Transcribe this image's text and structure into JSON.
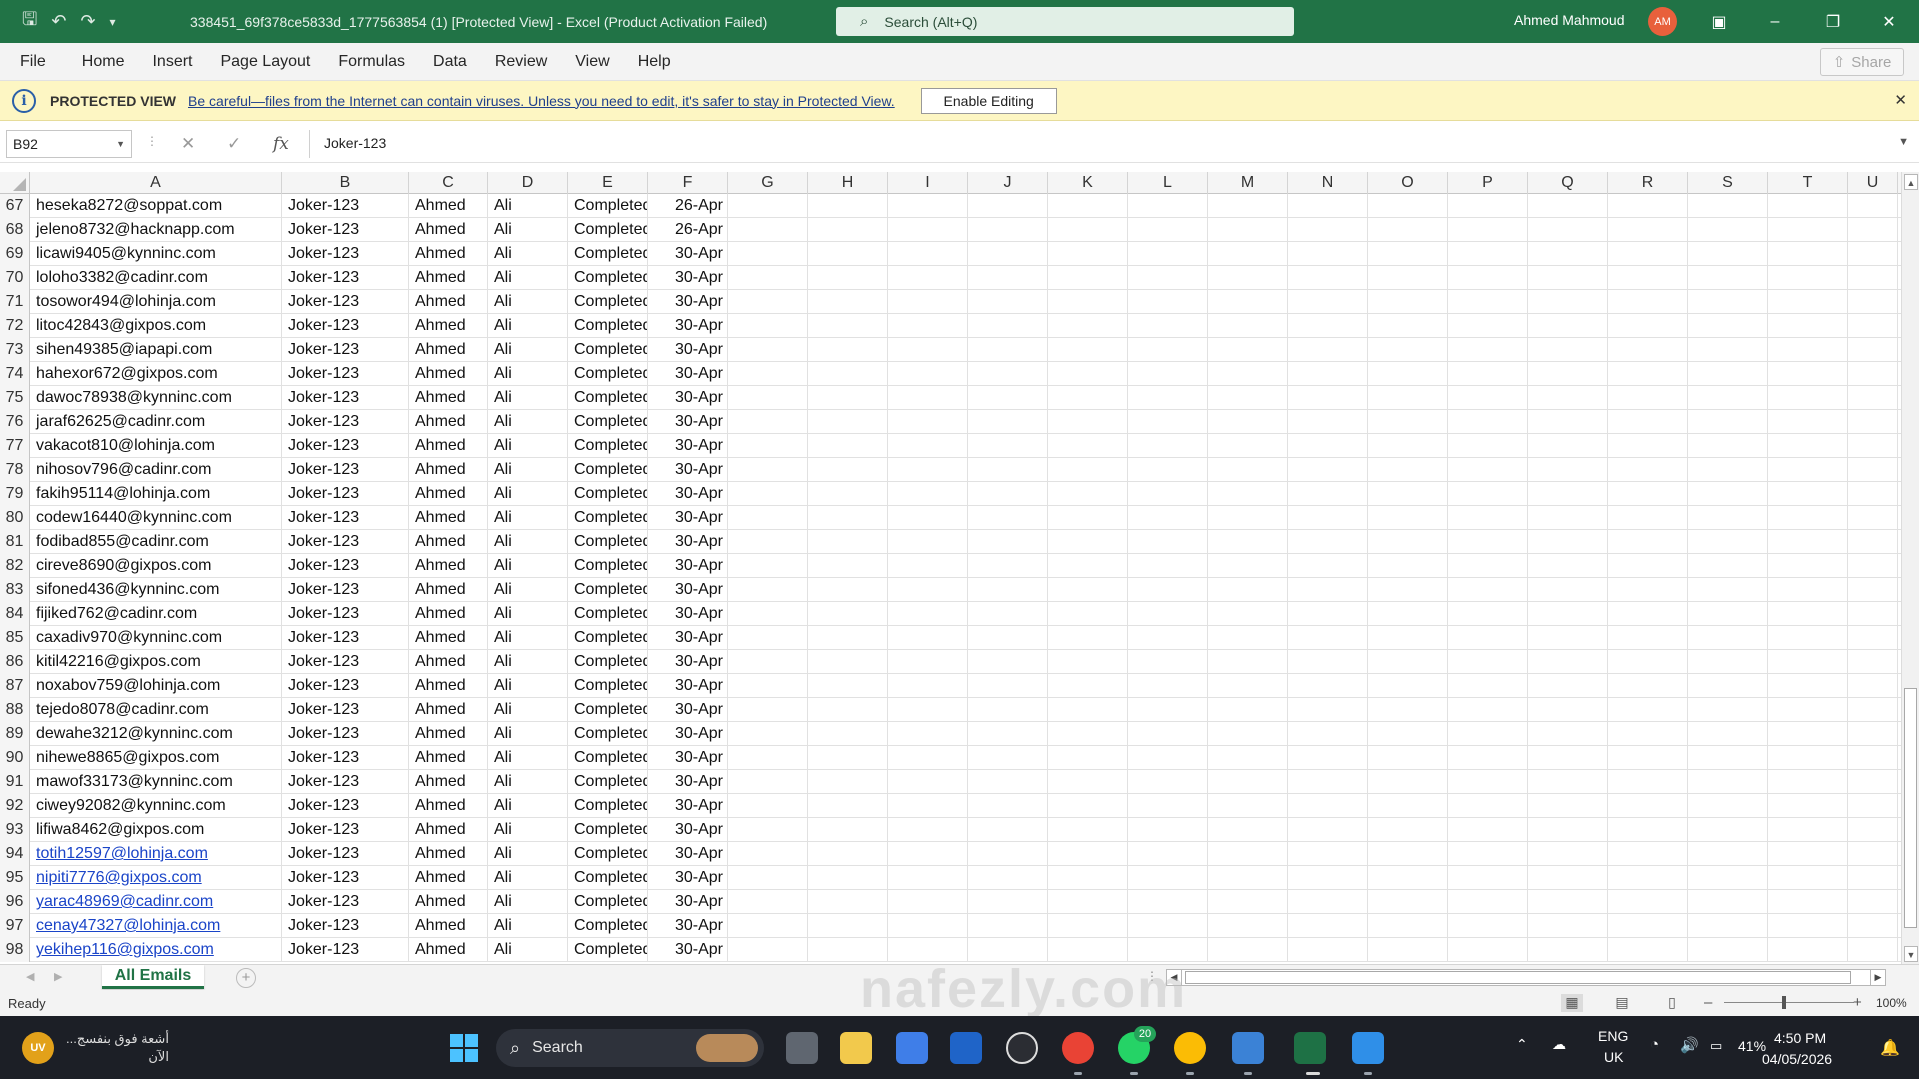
{
  "titlebar": {
    "title": "338451_69f378ce5833d_1777563854 (1)  [Protected View]  -  Excel (Product Activation Failed)",
    "search_placeholder": "Search (Alt+Q)",
    "user_name": "Ahmed Mahmoud",
    "user_initials": "AM",
    "accent_color": "#217346"
  },
  "ribbon": {
    "tabs": [
      "File",
      "Home",
      "Insert",
      "Page Layout",
      "Formulas",
      "Data",
      "Review",
      "View",
      "Help"
    ],
    "share_label": "Share"
  },
  "protected_view": {
    "label": "PROTECTED VIEW",
    "message": "Be careful—files from the Internet can contain viruses. Unless you need to edit, it's safer to stay in Protected View.",
    "enable_button": "Enable Editing"
  },
  "formula_bar": {
    "name_box": "B92",
    "value": "Joker-123"
  },
  "columns": [
    "A",
    "B",
    "C",
    "D",
    "E",
    "F",
    "G",
    "H",
    "I",
    "J",
    "K",
    "L",
    "M",
    "N",
    "O",
    "P",
    "Q",
    "R",
    "S",
    "T",
    "U"
  ],
  "rows": [
    {
      "n": "67",
      "a": "heseka8272@soppat.com",
      "b": "Joker-123",
      "c": "Ahmed",
      "d": "Ali",
      "e": "Completed",
      "f": "26-Apr",
      "link": false
    },
    {
      "n": "68",
      "a": "jeleno8732@hacknapp.com",
      "b": "Joker-123",
      "c": "Ahmed",
      "d": "Ali",
      "e": "Completed",
      "f": "26-Apr",
      "link": false
    },
    {
      "n": "69",
      "a": "licawi9405@kynninc.com",
      "b": "Joker-123",
      "c": "Ahmed",
      "d": "Ali",
      "e": "Completed",
      "f": "30-Apr",
      "link": false
    },
    {
      "n": "70",
      "a": "loloho3382@cadinr.com",
      "b": "Joker-123",
      "c": "Ahmed",
      "d": "Ali",
      "e": "Completed",
      "f": "30-Apr",
      "link": false
    },
    {
      "n": "71",
      "a": "tosowor494@lohinja.com",
      "b": "Joker-123",
      "c": "Ahmed",
      "d": "Ali",
      "e": "Completed",
      "f": "30-Apr",
      "link": false
    },
    {
      "n": "72",
      "a": "litoc42843@gixpos.com",
      "b": "Joker-123",
      "c": "Ahmed",
      "d": "Ali",
      "e": "Completed",
      "f": "30-Apr",
      "link": false
    },
    {
      "n": "73",
      "a": "sihen49385@iapapi.com",
      "b": "Joker-123",
      "c": "Ahmed",
      "d": "Ali",
      "e": "Completed",
      "f": "30-Apr",
      "link": false
    },
    {
      "n": "74",
      "a": "hahexor672@gixpos.com",
      "b": "Joker-123",
      "c": "Ahmed",
      "d": "Ali",
      "e": "Completed",
      "f": "30-Apr",
      "link": false
    },
    {
      "n": "75",
      "a": "dawoc78938@kynninc.com",
      "b": "Joker-123",
      "c": "Ahmed",
      "d": "Ali",
      "e": "Completed",
      "f": "30-Apr",
      "link": false
    },
    {
      "n": "76",
      "a": "jaraf62625@cadinr.com",
      "b": "Joker-123",
      "c": "Ahmed",
      "d": "Ali",
      "e": "Completed",
      "f": "30-Apr",
      "link": false
    },
    {
      "n": "77",
      "a": "vakacot810@lohinja.com",
      "b": "Joker-123",
      "c": "Ahmed",
      "d": "Ali",
      "e": "Completed",
      "f": "30-Apr",
      "link": false
    },
    {
      "n": "78",
      "a": "nihosov796@cadinr.com",
      "b": "Joker-123",
      "c": "Ahmed",
      "d": "Ali",
      "e": "Completed",
      "f": "30-Apr",
      "link": false
    },
    {
      "n": "79",
      "a": "fakih95114@lohinja.com",
      "b": "Joker-123",
      "c": "Ahmed",
      "d": "Ali",
      "e": "Completed",
      "f": "30-Apr",
      "link": false
    },
    {
      "n": "80",
      "a": "codew16440@kynninc.com",
      "b": "Joker-123",
      "c": "Ahmed",
      "d": "Ali",
      "e": "Completed",
      "f": "30-Apr",
      "link": false
    },
    {
      "n": "81",
      "a": "fodibad855@cadinr.com",
      "b": "Joker-123",
      "c": "Ahmed",
      "d": "Ali",
      "e": "Completed",
      "f": "30-Apr",
      "link": false
    },
    {
      "n": "82",
      "a": "cireve8690@gixpos.com",
      "b": "Joker-123",
      "c": "Ahmed",
      "d": "Ali",
      "e": "Completed",
      "f": "30-Apr",
      "link": false
    },
    {
      "n": "83",
      "a": "sifoned436@kynninc.com",
      "b": "Joker-123",
      "c": "Ahmed",
      "d": "Ali",
      "e": "Completed",
      "f": "30-Apr",
      "link": false
    },
    {
      "n": "84",
      "a": "fijiked762@cadinr.com",
      "b": "Joker-123",
      "c": "Ahmed",
      "d": "Ali",
      "e": "Completed",
      "f": "30-Apr",
      "link": false
    },
    {
      "n": "85",
      "a": "caxadiv970@kynninc.com",
      "b": "Joker-123",
      "c": "Ahmed",
      "d": "Ali",
      "e": "Completed",
      "f": "30-Apr",
      "link": false
    },
    {
      "n": "86",
      "a": "kitil42216@gixpos.com",
      "b": "Joker-123",
      "c": "Ahmed",
      "d": "Ali",
      "e": "Completed",
      "f": "30-Apr",
      "link": false
    },
    {
      "n": "87",
      "a": "noxabov759@lohinja.com",
      "b": "Joker-123",
      "c": "Ahmed",
      "d": "Ali",
      "e": "Completed",
      "f": "30-Apr",
      "link": false
    },
    {
      "n": "88",
      "a": "tejedo8078@cadinr.com",
      "b": "Joker-123",
      "c": "Ahmed",
      "d": "Ali",
      "e": "Completed",
      "f": "30-Apr",
      "link": false
    },
    {
      "n": "89",
      "a": "dewahe3212@kynninc.com",
      "b": "Joker-123",
      "c": "Ahmed",
      "d": "Ali",
      "e": "Completed",
      "f": "30-Apr",
      "link": false
    },
    {
      "n": "90",
      "a": "nihewe8865@gixpos.com",
      "b": "Joker-123",
      "c": "Ahmed",
      "d": "Ali",
      "e": "Completed",
      "f": "30-Apr",
      "link": false
    },
    {
      "n": "91",
      "a": "mawof33173@kynninc.com",
      "b": "Joker-123",
      "c": "Ahmed",
      "d": "Ali",
      "e": "Completed",
      "f": "30-Apr",
      "link": false
    },
    {
      "n": "92",
      "a": "ciwey92082@kynninc.com",
      "b": "Joker-123",
      "c": "Ahmed",
      "d": "Ali",
      "e": "Completed",
      "f": "30-Apr",
      "link": false
    },
    {
      "n": "93",
      "a": "lifiwa8462@gixpos.com",
      "b": "Joker-123",
      "c": "Ahmed",
      "d": "Ali",
      "e": "Completed",
      "f": "30-Apr",
      "link": false
    },
    {
      "n": "94",
      "a": "totih12597@lohinja.com",
      "b": "Joker-123",
      "c": "Ahmed",
      "d": "Ali",
      "e": "Completed",
      "f": "30-Apr",
      "link": true
    },
    {
      "n": "95",
      "a": "nipiti7776@gixpos.com",
      "b": "Joker-123",
      "c": "Ahmed",
      "d": "Ali",
      "e": "Completed",
      "f": "30-Apr",
      "link": true
    },
    {
      "n": "96",
      "a": "yarac48969@cadinr.com",
      "b": "Joker-123",
      "c": "Ahmed",
      "d": "Ali",
      "e": "Completed",
      "f": "30-Apr",
      "link": true
    },
    {
      "n": "97",
      "a": "cenay47327@lohinja.com",
      "b": "Joker-123",
      "c": "Ahmed",
      "d": "Ali",
      "e": "Completed",
      "f": "30-Apr",
      "link": true
    },
    {
      "n": "98",
      "a": "yekihep116@gixpos.com",
      "b": "Joker-123",
      "c": "Ahmed",
      "d": "Ali",
      "e": "Completed",
      "f": "30-Apr",
      "link": true
    }
  ],
  "sheet": {
    "active_tab": "All Emails"
  },
  "status": {
    "text": "Ready",
    "zoom": "100%"
  },
  "watermark": "nafezly.com",
  "taskbar": {
    "notification_text_1": "أشعة فوق بنفسج...",
    "notification_text_2": "الآن",
    "notification_badge": "UV",
    "search_label": "Search",
    "whatsapp_badge": "20",
    "lang_1": "ENG",
    "lang_2": "UK",
    "battery": "41%",
    "time": "4:50 PM",
    "date": "04/05/2026"
  }
}
